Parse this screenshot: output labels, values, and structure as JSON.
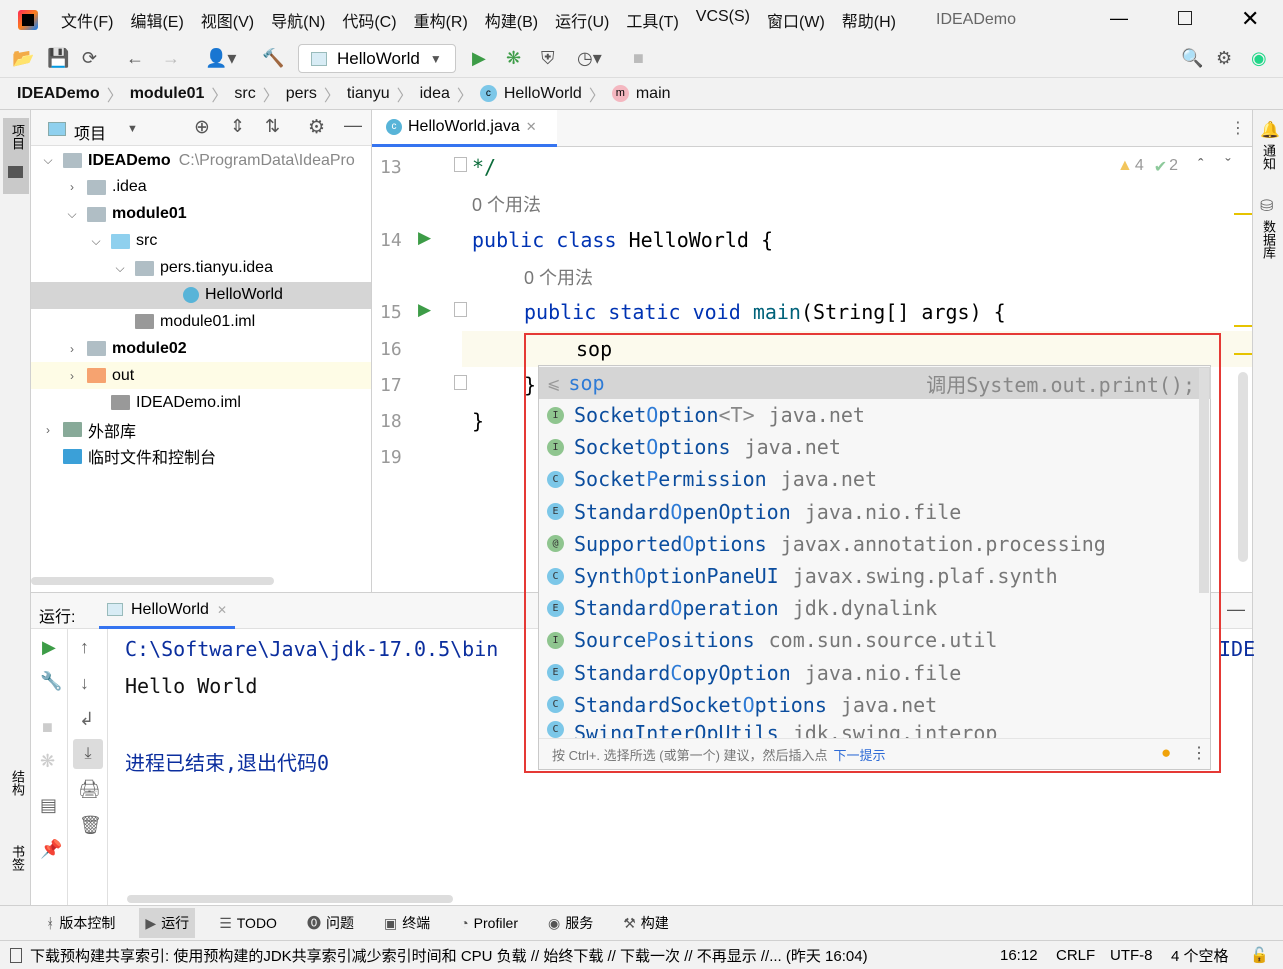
{
  "window": {
    "title": "IDEADemo",
    "menus": [
      "文件(F)",
      "编辑(E)",
      "视图(V)",
      "导航(N)",
      "代码(C)",
      "重构(R)",
      "构建(B)",
      "运行(U)",
      "工具(T)",
      "VCS(S)",
      "窗口(W)",
      "帮助(H)"
    ]
  },
  "toolbar": {
    "run_config": "HelloWorld"
  },
  "breadcrumb": [
    "IDEADemo",
    "module01",
    "src",
    "pers",
    "tianyu",
    "idea",
    "HelloWorld",
    "main"
  ],
  "left_strip": {
    "project": "项目",
    "structure": "结构",
    "bookmarks": "书签"
  },
  "right_strip": {
    "notifications": "通知",
    "database": "数据库"
  },
  "project": {
    "title": "项目",
    "tree": [
      {
        "label": "IDEADemo",
        "path": "C:\\ProgramData\\IdeaPro",
        "bold": true,
        "depth": 0,
        "expanded": true,
        "icon": "module-folder-icon"
      },
      {
        "label": ".idea",
        "depth": 1,
        "expanded": false,
        "icon": "folder-icon"
      },
      {
        "label": "module01",
        "bold": true,
        "depth": 1,
        "expanded": true,
        "icon": "module-folder-icon"
      },
      {
        "label": "src",
        "depth": 2,
        "expanded": true,
        "icon": "source-folder-icon"
      },
      {
        "label": "pers.tianyu.idea",
        "depth": 3,
        "expanded": true,
        "icon": "package-icon"
      },
      {
        "label": "HelloWorld",
        "depth": 5,
        "selected": true,
        "icon": "java-class-icon"
      },
      {
        "label": "module01.iml",
        "depth": 3,
        "icon": "iml-file-icon"
      },
      {
        "label": "module02",
        "bold": true,
        "depth": 1,
        "expanded": false,
        "icon": "module-folder-icon"
      },
      {
        "label": "out",
        "depth": 1,
        "expanded": false,
        "icon": "excluded-folder-icon"
      },
      {
        "label": "IDEADemo.iml",
        "depth": 2,
        "icon": "iml-file-icon"
      },
      {
        "label": "外部库",
        "depth": 0,
        "expanded": false,
        "icon": "library-icon"
      },
      {
        "label": "临时文件和控制台",
        "depth": 0,
        "icon": "scratches-icon"
      }
    ]
  },
  "editor": {
    "tab": "HelloWorld.java",
    "warnings": "4",
    "typos": "2",
    "lines": [
      {
        "n": "13",
        "code": "*/",
        "indent": 0
      },
      {
        "hint": "0 个用法",
        "indent": 0
      },
      {
        "n": "14",
        "code": "public class HelloWorld {",
        "indent": 0,
        "run": true
      },
      {
        "hint": "0 个用法",
        "indent": 1
      },
      {
        "n": "15",
        "code": "public static void main(String[] args) {",
        "indent": 1,
        "run": true
      },
      {
        "n": "16",
        "code": "sop",
        "indent": 2,
        "current": true
      },
      {
        "n": "17",
        "code": "}",
        "indent": 1
      },
      {
        "n": "18",
        "code": "}",
        "indent": 0
      },
      {
        "n": "19",
        "code": "",
        "indent": 0
      }
    ]
  },
  "completion": {
    "first": {
      "name": "sop",
      "detail": "调用System.out.print();"
    },
    "items": [
      {
        "kind": "I",
        "pre": "Socket",
        "match": "O",
        "post": "ption",
        "tp": "<T>",
        "pkg": "java.net"
      },
      {
        "kind": "I",
        "pre": "Socket",
        "match": "O",
        "post": "ptions",
        "pkg": "java.net"
      },
      {
        "kind": "C",
        "pre": "Socket",
        "match": "P",
        "post": "ermission",
        "pkg": "java.net"
      },
      {
        "kind": "E",
        "pre": "Standard",
        "match": "O",
        "post": "penOption",
        "pkg": "java.nio.file"
      },
      {
        "kind": "@",
        "pre": "Supported",
        "match": "O",
        "post": "ptions",
        "pkg": "javax.annotation.processing"
      },
      {
        "kind": "C",
        "pre": "Synth",
        "match": "O",
        "post": "ptionPaneUI",
        "pkg": "javax.swing.plaf.synth"
      },
      {
        "kind": "E",
        "pre": "Standard",
        "match": "O",
        "post": "peration",
        "pkg": "jdk.dynalink"
      },
      {
        "kind": "I",
        "pre": "Source",
        "match": "P",
        "post": "ositions",
        "pkg": "com.sun.source.util"
      },
      {
        "kind": "E",
        "pre": "Standard",
        "match": "C",
        "post": "opyOption",
        "pkg": "java.nio.file"
      },
      {
        "kind": "C",
        "pre": "StandardSocket",
        "match": "O",
        "post": "ptions",
        "pkg": "java.net"
      },
      {
        "kind": "C",
        "pre": "SwingInterOpUtils",
        "match": "",
        "post": "",
        "pkg": "jdk.swing.interop"
      }
    ],
    "footer": "按 Ctrl+. 选择所选 (或第一个) 建议，然后插入点",
    "footer_link": "下一提示"
  },
  "run": {
    "label": "运行:",
    "tab": "HelloWorld",
    "console": [
      "C:\\Software\\Java\\jdk-17.0.5\\bin",
      "Hello World",
      "",
      "进程已结束,退出代码0"
    ],
    "right_clip": "IDE"
  },
  "bottom_tabs": [
    "版本控制",
    "运行",
    "TODO",
    "问题",
    "终端",
    "Profiler",
    "服务",
    "构建"
  ],
  "status": {
    "message": "下载预构建共享索引: 使用预构建的JDK共享索引减少索引时间和 CPU 负载 // 始终下载 // 下载一次 // 不再显示 //... (昨天 16:04)",
    "position": "16:12",
    "line_sep": "CRLF",
    "encoding": "UTF-8",
    "indent": "4 个空格"
  },
  "colors": {
    "keyword": "#0033b3",
    "match": "#2e7bd6",
    "highlight_box": "#e53935",
    "run": "#3d9c47"
  }
}
